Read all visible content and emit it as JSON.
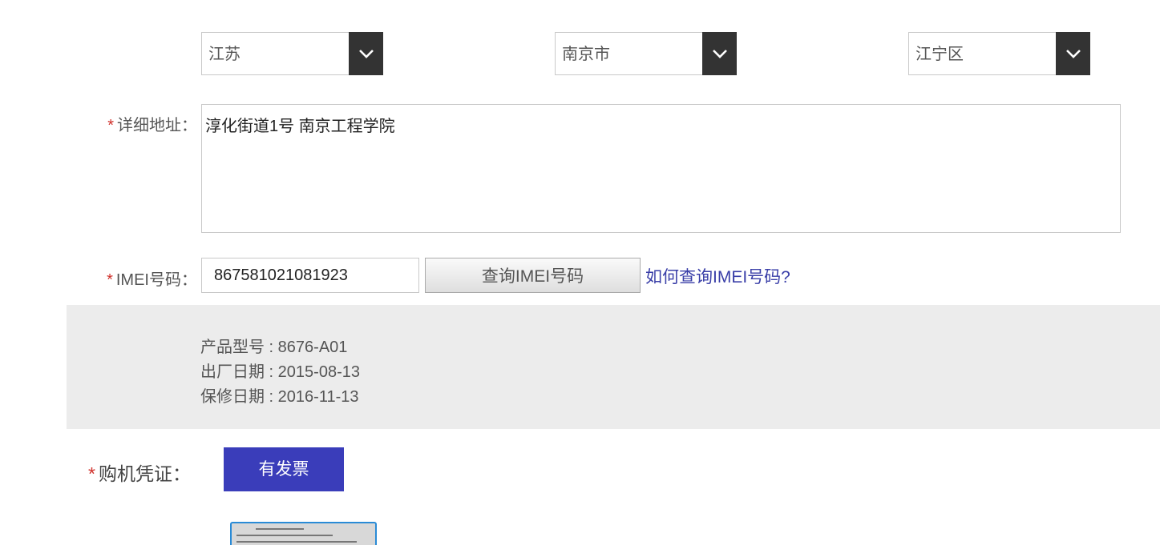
{
  "region": {
    "province": "江苏",
    "city": "南京市",
    "district": "江宁区"
  },
  "address": {
    "required_mark": "*",
    "label": "详细地址：",
    "value": "淳化街道1号 南京工程学院"
  },
  "imei": {
    "required_mark": "*",
    "label": "IMEI号码：",
    "value": "867581021081923",
    "query_button": "查询IMEI号码",
    "help_link": "如何查询IMEI号码?"
  },
  "product_info": {
    "model": "产品型号 : 8676-A01",
    "manufacture_date": "出厂日期 : 2015-08-13",
    "warranty_date": "保修日期 : 2016-11-13"
  },
  "proof": {
    "required_mark": "*",
    "label": "购机凭证：",
    "invoice_button": "有发票"
  },
  "colors": {
    "accent": "#3a3dba",
    "link": "#3a3fa8",
    "required": "#d0302a",
    "panel": "#ececec"
  }
}
